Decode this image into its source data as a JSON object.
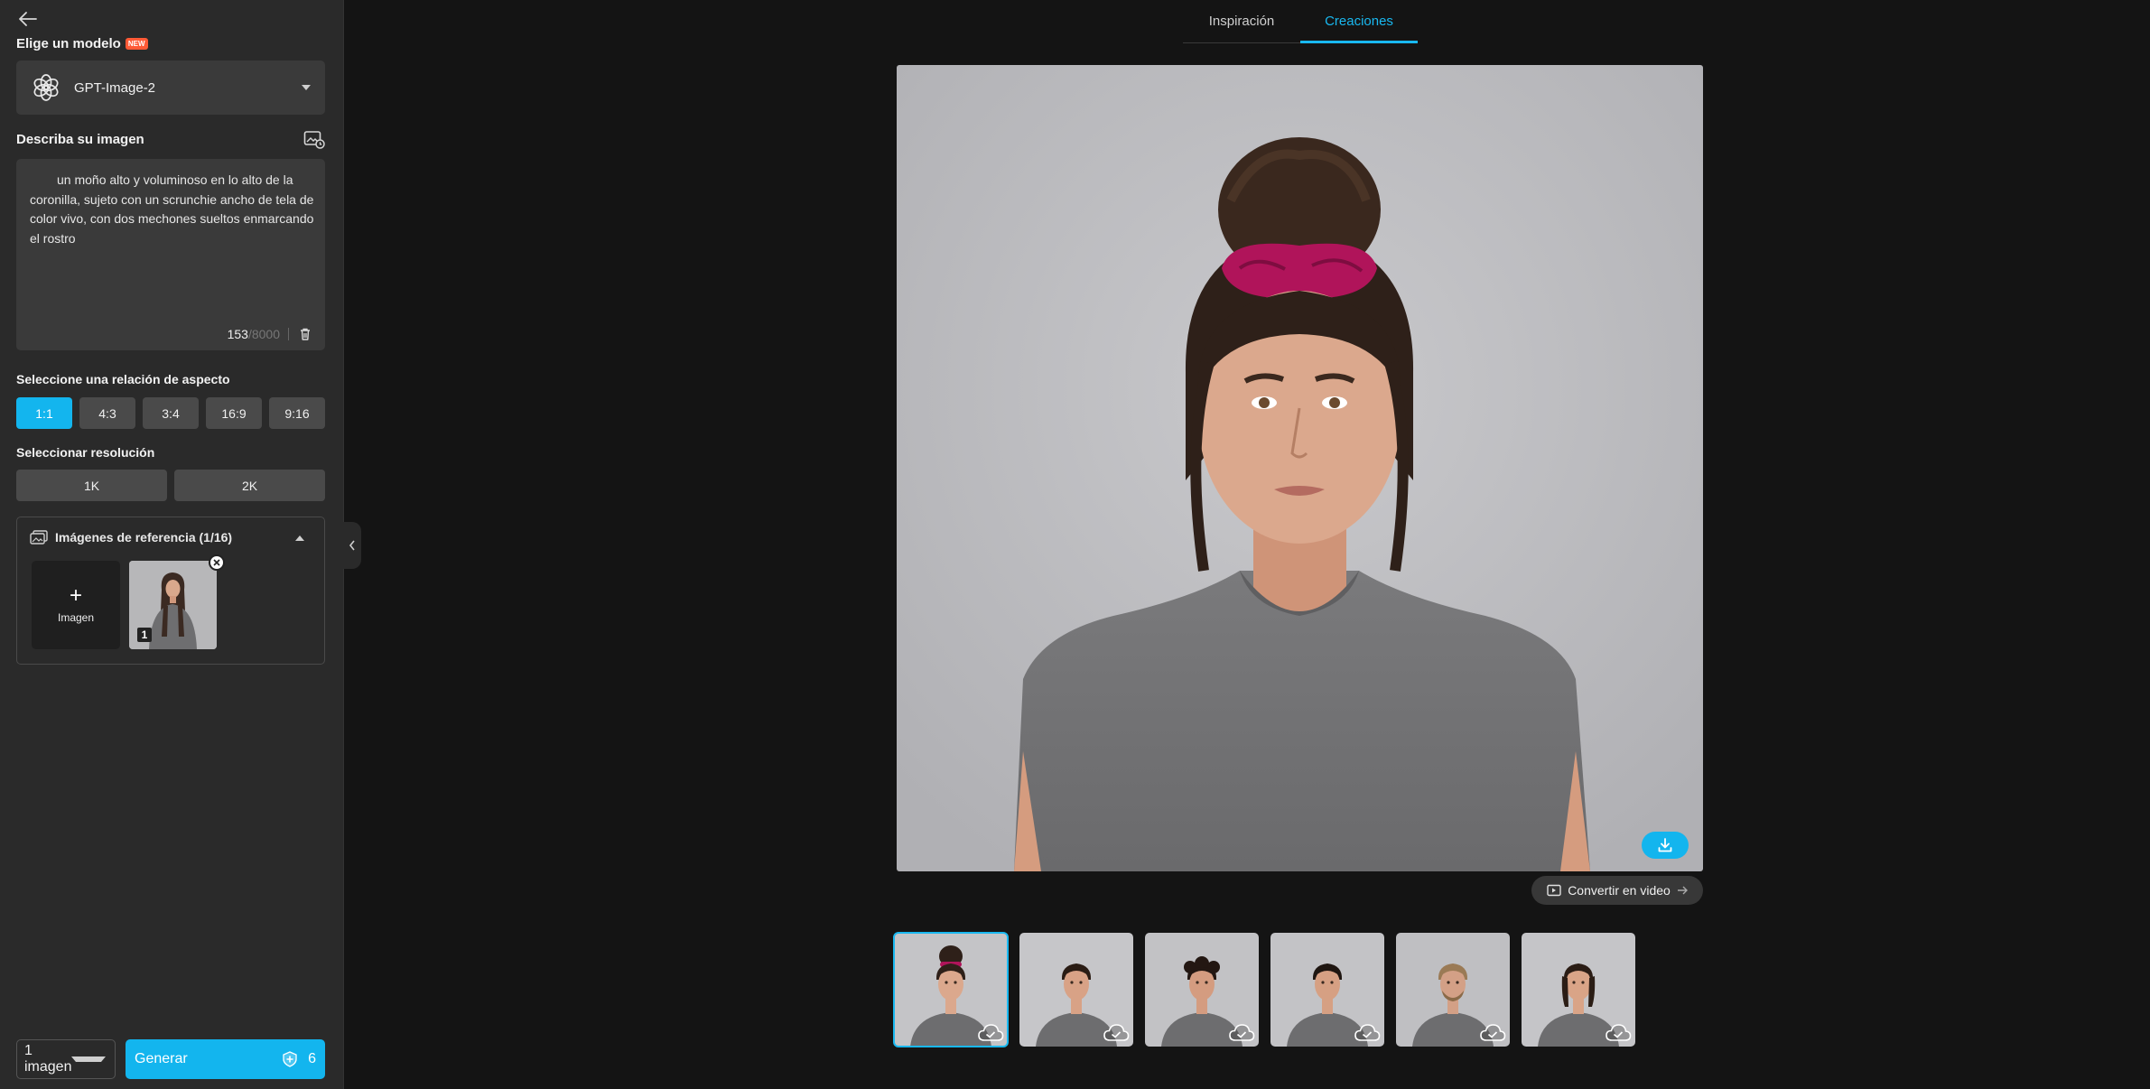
{
  "sidebar": {
    "model_label": "Elige un modelo",
    "new_badge": "NEW",
    "model_name": "GPT-Image-2",
    "describe_label": "Describa su imagen",
    "prompt_text": "un moño alto y voluminoso en lo alto de la coronilla, sujeto con un scrunchie ancho de tela de color vivo, con dos mechones sueltos enmarcando el rostro",
    "char_count": "153",
    "char_max": "/8000",
    "ratio_label": "Seleccione una relación de aspecto",
    "ratios": [
      {
        "label": "1:1",
        "active": true
      },
      {
        "label": "4:3",
        "active": false
      },
      {
        "label": "3:4",
        "active": false
      },
      {
        "label": "16:9",
        "active": false
      },
      {
        "label": "9:16",
        "active": false
      }
    ],
    "resolution_label": "Seleccionar resolución",
    "resolutions": [
      {
        "label": "1K",
        "active": false
      },
      {
        "label": "2K",
        "active": true
      }
    ],
    "refs_title": "Imágenes de referencia (1/16)",
    "add_image_label": "Imagen",
    "ref_index": "1",
    "count_value": "1 imagen",
    "generate_label": "Generar",
    "credits": "6"
  },
  "tabs": [
    {
      "label": "Inspiración",
      "active": false
    },
    {
      "label": "Creaciones",
      "active": true
    }
  ],
  "main": {
    "convert_video_label": "Convertir en video",
    "history_count": 6,
    "selected_index": 0
  },
  "colors": {
    "accent": "#13b5ee",
    "sidebar_bg": "#2a2a2a",
    "page_bg": "#141414",
    "scrunchie": "#b0145a"
  }
}
